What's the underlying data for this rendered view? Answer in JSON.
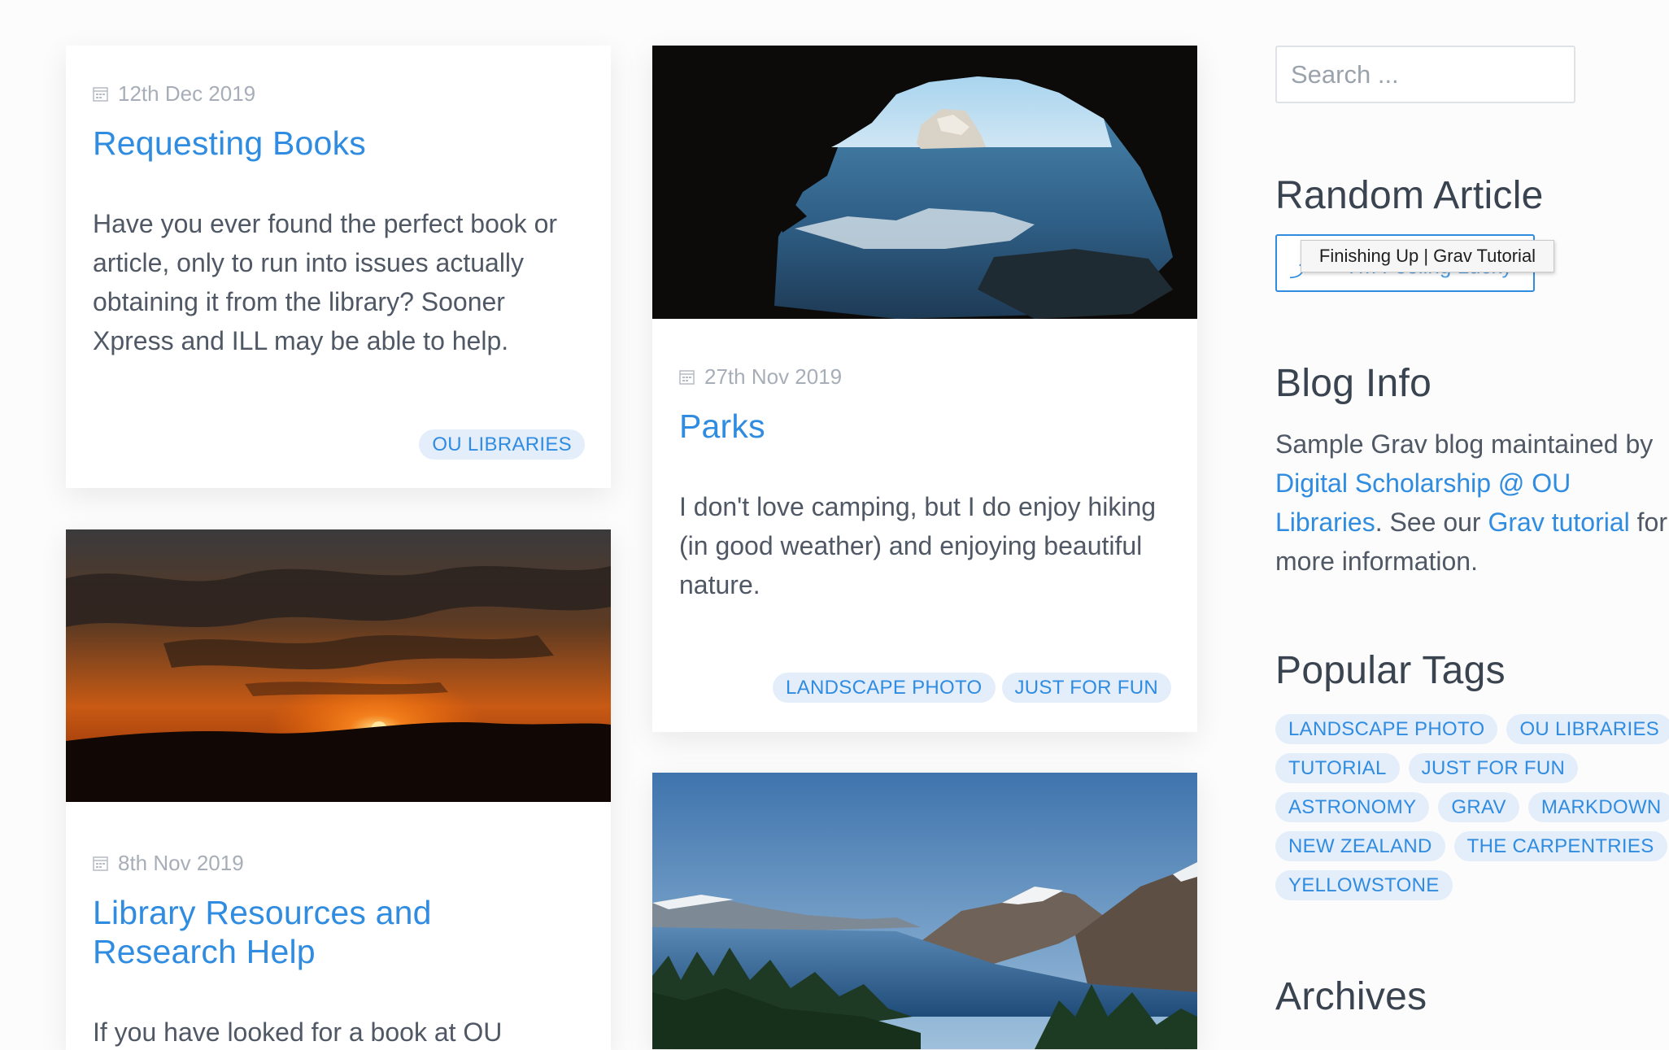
{
  "posts": [
    {
      "date": "12th Dec 2019",
      "title": "Requesting Books",
      "excerpt": "Have you ever found the perfect book or article, only to run into issues actually obtaining it from the library? Sooner Xpress and ILL may be able to help.",
      "tags": [
        "OU LIBRARIES"
      ]
    },
    {
      "date": "27th Nov 2019",
      "title": "Parks",
      "excerpt": "I don't love camping, but I do enjoy hiking (in good weather) and enjoying beautiful nature.",
      "tags": [
        "LANDSCAPE PHOTO",
        "JUST FOR FUN"
      ]
    },
    {
      "date": "8th Nov 2019",
      "title": "Library Resources and Research Help",
      "excerpt": "If you have looked for a book at OU"
    }
  ],
  "sidebar": {
    "search_placeholder": "Search ...",
    "random_heading": "Random Article",
    "random_button_icon": "shuffle-icon",
    "random_button_label": "I'm Feeling Lucky",
    "tooltip": "Finishing Up | Grav Tutorial",
    "blog_info_heading": "Blog Info",
    "blog_info": {
      "pre": "Sample Grav blog maintained by ",
      "link1": "Digital Scholarship @ OU Libraries",
      "mid": ". See our ",
      "link2": "Grav tutorial",
      "post": " for more information."
    },
    "popular_tags_heading": "Popular Tags",
    "popular_tags": [
      "LANDSCAPE PHOTO",
      "OU LIBRARIES",
      "TUTORIAL",
      "JUST FOR FUN",
      "ASTRONOMY",
      "GRAV",
      "MARKDOWN",
      "NEW ZEALAND",
      "THE CARPENTRIES",
      "YELLOWSTONE"
    ],
    "archives_heading": "Archives"
  },
  "colors": {
    "link": "#2f8ce0",
    "tag_bg": "#e4eefb",
    "date": "#a7aeb7",
    "text": "#4f5864"
  }
}
